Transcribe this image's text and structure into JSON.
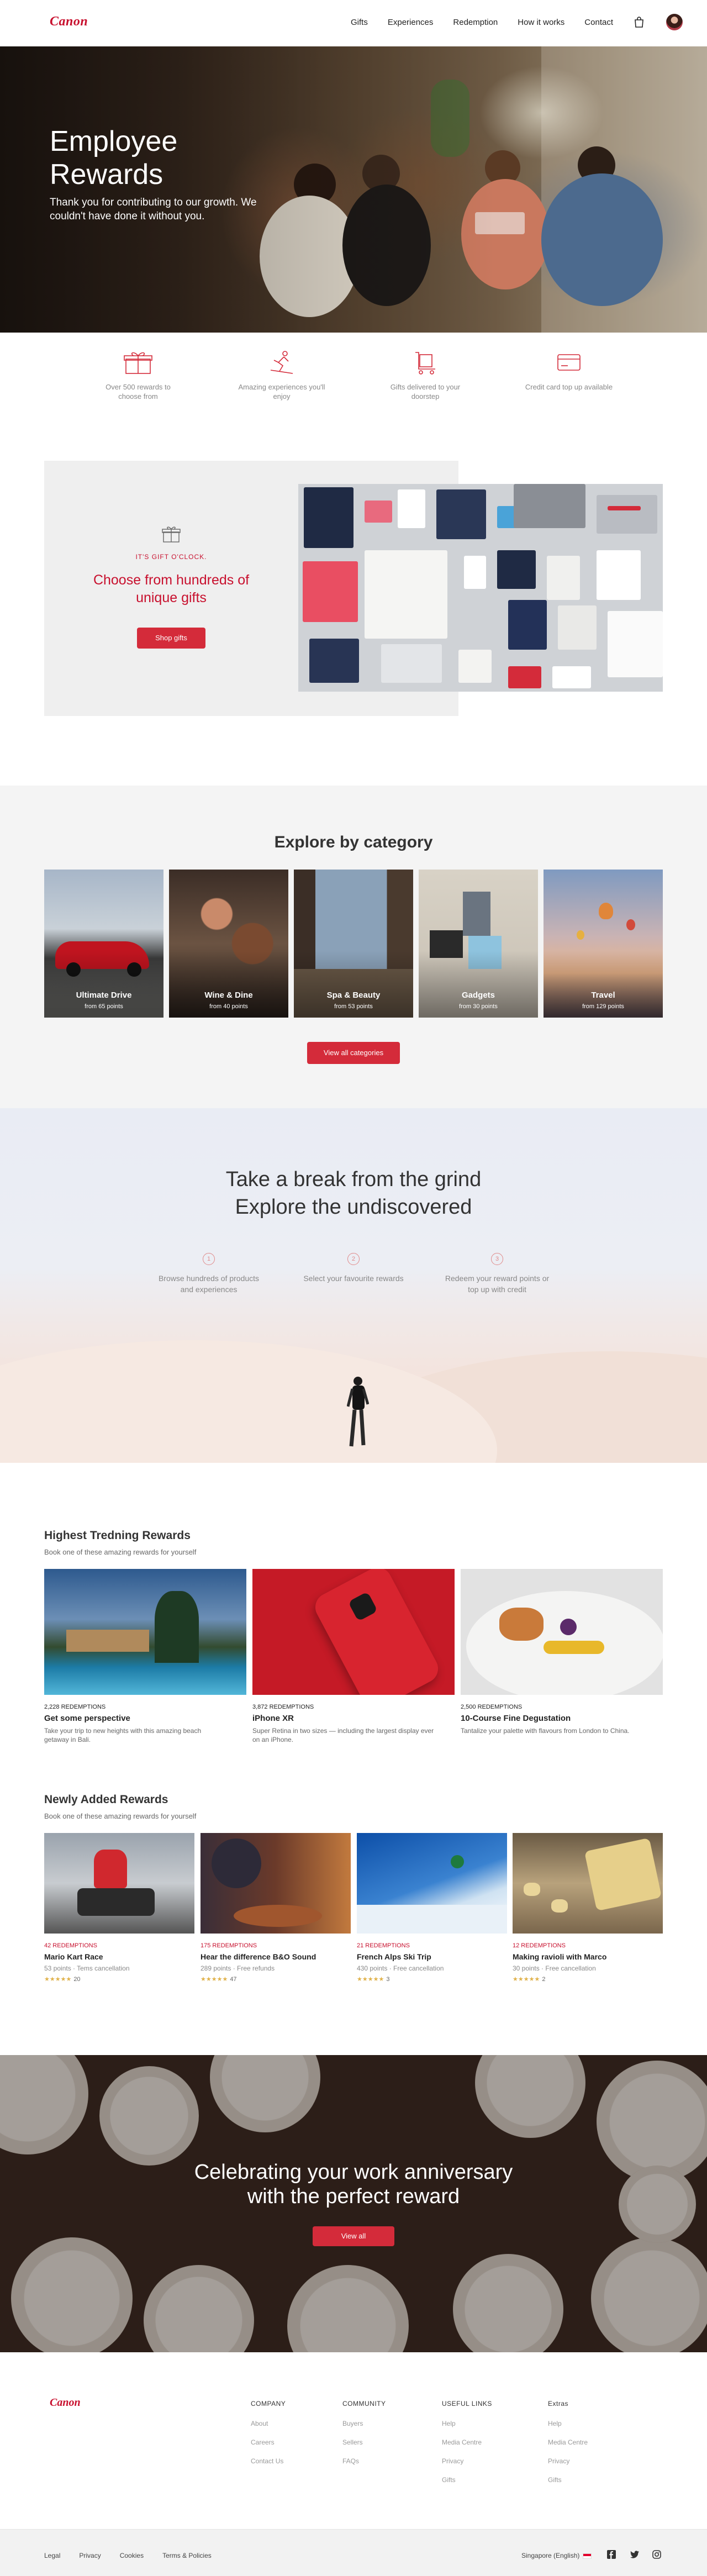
{
  "brand": {
    "logo_text": "Canon",
    "accent_color": "#d42b3a"
  },
  "nav": {
    "items": [
      "Gifts",
      "Experiences",
      "Redemption",
      "How it works",
      "Contact"
    ]
  },
  "hero": {
    "title": "Employee Rewards",
    "subtitle": "Thank you for contributing to our growth. We couldn't have done it without you."
  },
  "features": [
    {
      "icon": "gift-box-icon",
      "text": "Over 500 rewards to choose from"
    },
    {
      "icon": "skier-icon",
      "text": "Amazing experiences you'll enjoy"
    },
    {
      "icon": "delivery-cart-icon",
      "text": "Gifts delivered to your doorstep"
    },
    {
      "icon": "credit-card-icon",
      "text": "Credit card top up available"
    }
  ],
  "promo": {
    "eyebrow": "IT'S GIFT O'CLOCK.",
    "title": "Choose from hundreds of unique gifts",
    "button": "Shop gifts"
  },
  "categories": {
    "title": "Explore by category",
    "items": [
      {
        "name": "Ultimate Drive",
        "from": "from 65 points"
      },
      {
        "name": "Wine & Dine",
        "from": "from 40 points"
      },
      {
        "name": "Spa & Beauty",
        "from": "from 53 points"
      },
      {
        "name": "Gadgets",
        "from": "from 30 points"
      },
      {
        "name": "Travel",
        "from": "from 129 points"
      }
    ],
    "button": "View all categories"
  },
  "break_section": {
    "title_line1": "Take a break from the grind",
    "title_line2": "Explore the undiscovered",
    "steps": [
      {
        "num": "1",
        "text": "Browse hundreds of products and experiences"
      },
      {
        "num": "2",
        "text": "Select your favourite rewards"
      },
      {
        "num": "3",
        "text": "Redeem your reward points or top up with credit"
      }
    ]
  },
  "trending": {
    "title": "Highest Tredning Rewards",
    "subtitle": "Book one of these amazing rewards for yourself",
    "items": [
      {
        "meta": "2,228 REDEMPTIONS",
        "name": "Get some perspective",
        "desc": "Take your trip to new heights with this amazing beach getaway in Bali."
      },
      {
        "meta": "3,872 REDEMPTIONS",
        "name": "iPhone XR",
        "desc": "Super Retina in two sizes — including the largest display ever on an iPhone."
      },
      {
        "meta": "2,500 REDEMPTIONS",
        "name": "10-Course Fine Degustation",
        "desc": "Tantalize your palette with flavours from London to China."
      }
    ]
  },
  "new_rewards": {
    "title": "Newly Added Rewards",
    "subtitle": "Book one of these amazing rewards for yourself",
    "items": [
      {
        "meta": "42 REDEMPTIONS",
        "name": "Mario Kart Race",
        "info": "53 points · Tems cancellation",
        "stars": "★★★★★",
        "count": "20"
      },
      {
        "meta": "175 REDEMPTIONS",
        "name": "Hear the difference B&O Sound",
        "info": "289 points · Free refunds",
        "stars": "★★★★★",
        "count": "47"
      },
      {
        "meta": "21 REDEMPTIONS",
        "name": "French Alps Ski Trip",
        "info": "430 points · Free cancellation",
        "stars": "★★★★★",
        "count": "3"
      },
      {
        "meta": "12 REDEMPTIONS",
        "name": "Making ravioli with Marco",
        "info": "30 points · Free cancellation",
        "stars": "★★★★★",
        "count": "2"
      }
    ]
  },
  "anniversary": {
    "title_line1": "Celebrating your work anniversary",
    "title_line2": "with the perfect reward",
    "button": "View all"
  },
  "footer": {
    "logo_text": "Canon",
    "columns": [
      {
        "heading": "COMPANY",
        "links": [
          "About",
          "Careers",
          "Contact Us"
        ]
      },
      {
        "heading": "COMMUNITY",
        "links": [
          "Buyers",
          "Sellers",
          "FAQs"
        ]
      },
      {
        "heading": "USEFUL LINKS",
        "links": [
          "Help",
          "Media Centre",
          "Privacy",
          "Gifts"
        ]
      },
      {
        "heading": "Extras",
        "links": [
          "Help",
          "Media Centre",
          "Privacy",
          "Gifts"
        ]
      }
    ],
    "bottom_links": [
      "Legal",
      "Privacy",
      "Cookies",
      "Terms & Policies"
    ],
    "language": "Singapore (English)",
    "social": [
      "facebook-icon",
      "twitter-icon",
      "instagram-icon"
    ]
  }
}
